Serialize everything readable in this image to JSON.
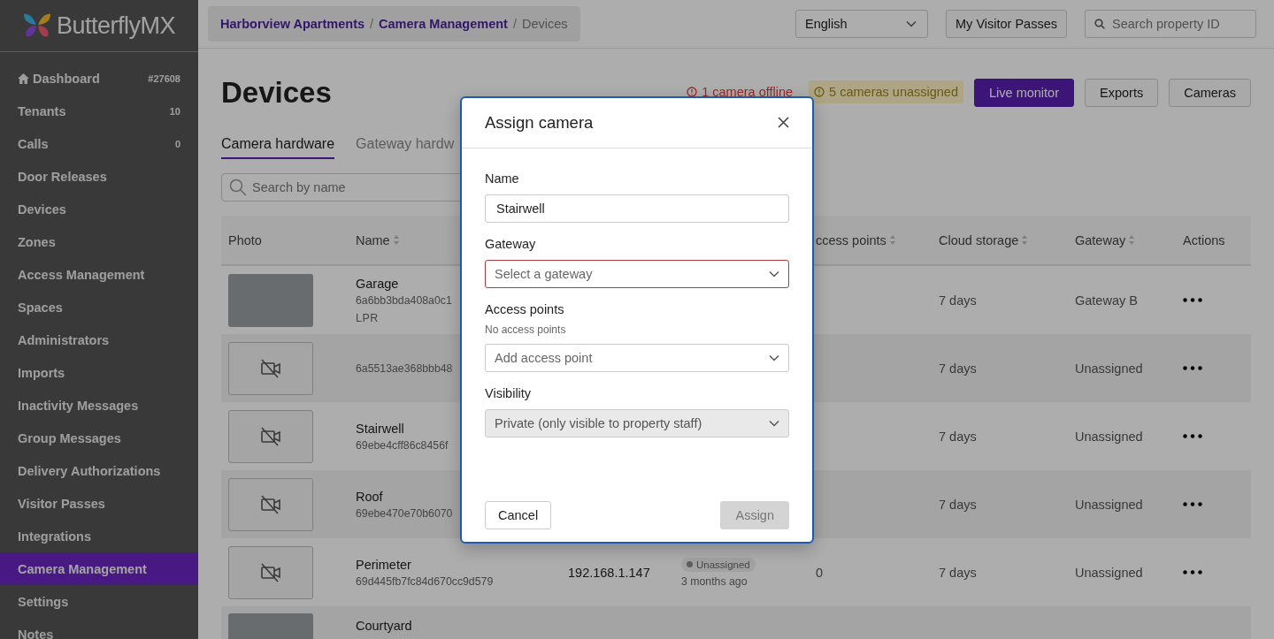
{
  "brand": {
    "name": "ButterflyMX"
  },
  "sidebar": {
    "items": [
      {
        "label": "Dashboard",
        "badge": "#27608",
        "selected": false
      },
      {
        "label": "Tenants",
        "badge": "10",
        "selected": false
      },
      {
        "label": "Calls",
        "badge": "0",
        "selected": false
      },
      {
        "label": "Door Releases",
        "selected": false
      },
      {
        "label": "Devices",
        "selected": false
      },
      {
        "label": "Zones",
        "selected": false
      },
      {
        "label": "Access Management",
        "selected": false
      },
      {
        "label": "Spaces",
        "selected": false
      },
      {
        "label": "Administrators",
        "selected": false
      },
      {
        "label": "Imports",
        "selected": false
      },
      {
        "label": "Inactivity Messages",
        "selected": false
      },
      {
        "label": "Group Messages",
        "selected": false
      },
      {
        "label": "Delivery Authorizations",
        "selected": false
      },
      {
        "label": "Visitor Passes",
        "selected": false
      },
      {
        "label": "Integrations",
        "selected": false
      },
      {
        "label": "Camera Management",
        "selected": true
      },
      {
        "label": "Settings",
        "selected": false
      },
      {
        "label": "Notes",
        "selected": false
      }
    ]
  },
  "breadcrumb": {
    "separator": "/",
    "items": [
      {
        "label": "Harborview Apartments",
        "kind": "link"
      },
      {
        "label": "Camera Management",
        "kind": "link"
      },
      {
        "label": "Devices",
        "kind": "current"
      }
    ]
  },
  "language_select": {
    "value": "English"
  },
  "visitor_passes_button": {
    "label": "My Visitor Passes"
  },
  "property_search": {
    "placeholder": "Search property ID"
  },
  "page_title": "Devices",
  "alerts": [
    {
      "kind": "offline",
      "text": "1 camera offline"
    },
    {
      "kind": "unassigned",
      "text": "5 cameras unassigned"
    }
  ],
  "header_buttons": [
    {
      "label": "Live monitor",
      "kind": "primary"
    },
    {
      "label": "Exports",
      "kind": "secondary"
    },
    {
      "label": "Cameras",
      "kind": "secondary"
    }
  ],
  "tabs": [
    {
      "label": "Camera hardware",
      "selected": true
    },
    {
      "label": "Gateway hardw",
      "selected": false
    }
  ],
  "search": {
    "placeholder": "Search by name"
  },
  "table": {
    "columns": [
      {
        "label": "Photo",
        "sortable": false
      },
      {
        "label": "Name",
        "sortable": true
      },
      {
        "label": "ccess points",
        "sortable": true
      },
      {
        "label": "Cloud storage",
        "sortable": true
      },
      {
        "label": "Gateway",
        "sortable": true
      },
      {
        "label": "Actions",
        "sortable": false
      }
    ],
    "rows": [
      {
        "has_photo": true,
        "name": "Garage",
        "id": "6a6bb3bda408a0c1",
        "tag": "LPR",
        "cloud_storage": "7 days",
        "gateway": "Gateway B"
      },
      {
        "has_photo": false,
        "id": "6a5513ae368bbb48",
        "cloud_storage": "7 days",
        "gateway": "Unassigned"
      },
      {
        "has_photo": false,
        "name": "Stairwell",
        "id": "69ebe4cff86c8456f",
        "cloud_storage": "7 days",
        "gateway": "Unassigned"
      },
      {
        "has_photo": false,
        "name": "Roof",
        "id": "69ebe470e70b6070",
        "cloud_storage": "7 days",
        "gateway": "Unassigned"
      },
      {
        "has_photo": false,
        "name": "Perimeter",
        "id": "69d445fb7fc84d670cc9d579",
        "ip": "192.168.1.147",
        "status": "Unassigned",
        "status_time": "3 months ago",
        "access_points": "0",
        "cloud_storage": "7 days",
        "gateway": "Unassigned"
      },
      {
        "has_photo": true,
        "name": "Courtyard"
      }
    ]
  },
  "dialog": {
    "title": "Assign camera",
    "fields": [
      {
        "kind": "text",
        "label": "Name",
        "value": "Stairwell"
      },
      {
        "kind": "select",
        "label": "Gateway",
        "placeholder": "Select a gateway",
        "invalid": true,
        "disabled": false
      },
      {
        "kind": "select",
        "label": "Access points",
        "hint": "No access points",
        "placeholder": "Add access point",
        "invalid": false,
        "disabled": false
      },
      {
        "kind": "select",
        "label": "Visibility",
        "value": "Private (only visible to property staff)",
        "invalid": false,
        "disabled": true
      }
    ],
    "buttons": [
      {
        "label": "Cancel",
        "kind": "secondary",
        "disabled": false
      },
      {
        "label": "Assign",
        "kind": "primary",
        "disabled": true
      }
    ]
  }
}
